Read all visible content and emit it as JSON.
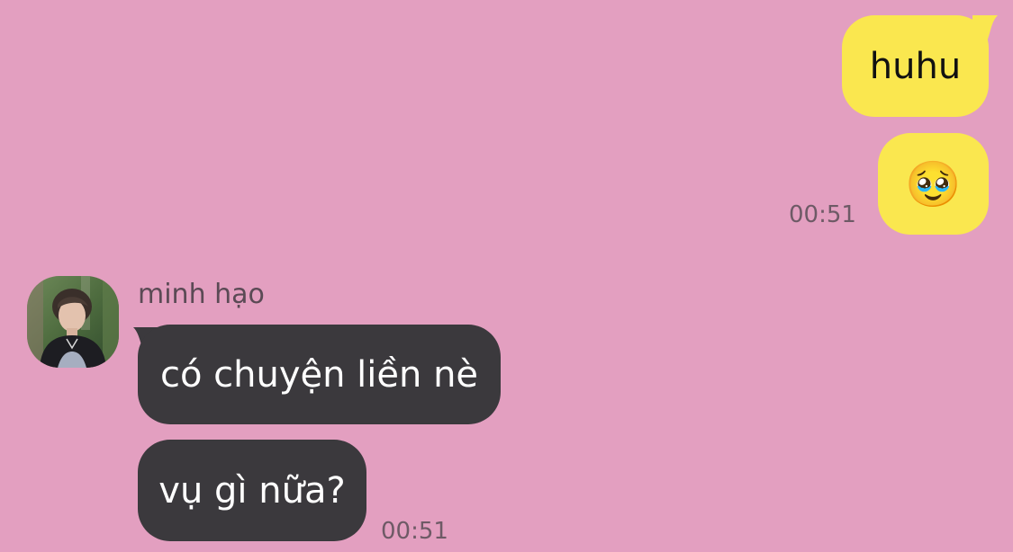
{
  "chat": {
    "messages": [
      {
        "direction": "out",
        "text": "huhu"
      },
      {
        "direction": "out",
        "text": "🥹",
        "emoji_name": "face-holding-back-tears-emoji",
        "time": "00:51"
      },
      {
        "direction": "in",
        "sender": "minh hạo",
        "text": "có chuyện liền nè"
      },
      {
        "direction": "in",
        "text": "vụ gì nữa?",
        "time": "00:51"
      }
    ]
  },
  "theme": {
    "background": "#e39fc0",
    "outgoing_bubble": "#fae74f",
    "incoming_bubble": "#3b393d",
    "incoming_text": "#ffffff",
    "timestamp_color": "#6e5a66"
  }
}
